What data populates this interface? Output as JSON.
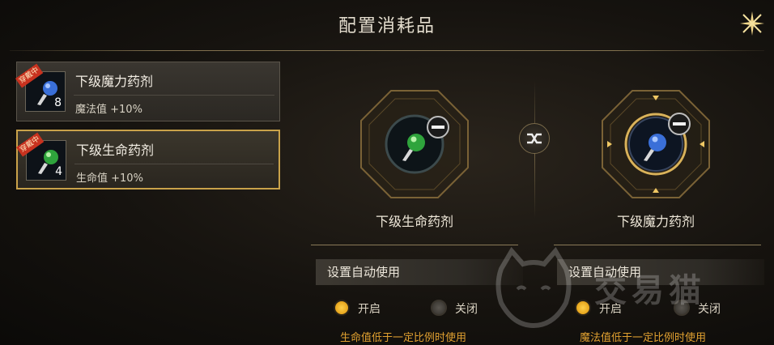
{
  "window": {
    "title": "配置消耗品"
  },
  "inventory": {
    "items": [
      {
        "name": "下级魔力药剂",
        "effect": "魔法值 +10%",
        "count": "8",
        "badge": "穿戴中",
        "color": "#3a6fd8"
      },
      {
        "name": "下级生命药剂",
        "effect": "生命值 +10%",
        "count": "4",
        "badge": "穿戴中",
        "color": "#2fa43c"
      }
    ]
  },
  "slots": [
    {
      "name": "下级生命药剂",
      "color": "#2fa43c"
    },
    {
      "name": "下级魔力药剂",
      "color": "#3a6fd8"
    }
  ],
  "auto_use": [
    {
      "heading": "设置自动使用",
      "on_label": "开启",
      "off_label": "关闭",
      "selected": "on",
      "hint": "生命值低于一定比例时使用"
    },
    {
      "heading": "设置自动使用",
      "on_label": "开启",
      "off_label": "关闭",
      "selected": "on",
      "hint": "魔法值低于一定比例时使用"
    }
  ],
  "watermark": {
    "text": "交易猫"
  },
  "icons": {
    "close": "close-star-icon",
    "swap": "swap-icon",
    "remove": "minus-icon"
  },
  "colors": {
    "accent": "#c9a24a",
    "hint": "#e0a030"
  }
}
